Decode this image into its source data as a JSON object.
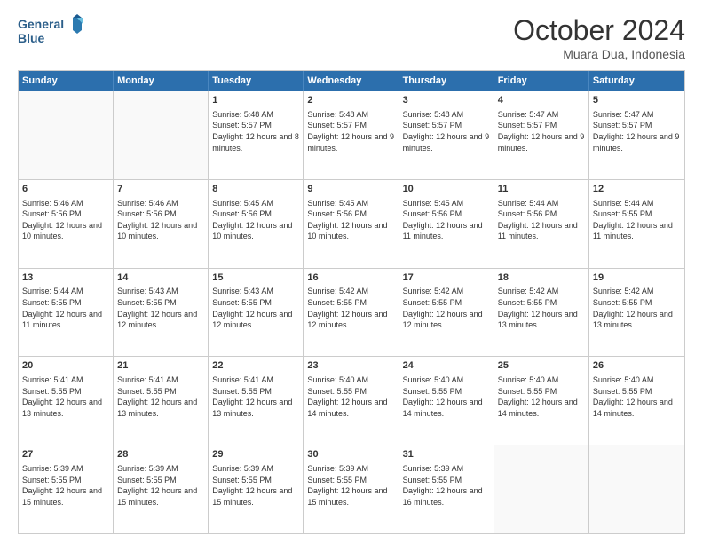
{
  "header": {
    "logo_line1": "General",
    "logo_line2": "Blue",
    "month_title": "October 2024",
    "location": "Muara Dua, Indonesia"
  },
  "weekdays": [
    "Sunday",
    "Monday",
    "Tuesday",
    "Wednesday",
    "Thursday",
    "Friday",
    "Saturday"
  ],
  "rows": [
    [
      {
        "day": "",
        "empty": true
      },
      {
        "day": "",
        "empty": true
      },
      {
        "day": "1",
        "sunrise": "Sunrise: 5:48 AM",
        "sunset": "Sunset: 5:57 PM",
        "daylight": "Daylight: 12 hours and 8 minutes."
      },
      {
        "day": "2",
        "sunrise": "Sunrise: 5:48 AM",
        "sunset": "Sunset: 5:57 PM",
        "daylight": "Daylight: 12 hours and 9 minutes."
      },
      {
        "day": "3",
        "sunrise": "Sunrise: 5:48 AM",
        "sunset": "Sunset: 5:57 PM",
        "daylight": "Daylight: 12 hours and 9 minutes."
      },
      {
        "day": "4",
        "sunrise": "Sunrise: 5:47 AM",
        "sunset": "Sunset: 5:57 PM",
        "daylight": "Daylight: 12 hours and 9 minutes."
      },
      {
        "day": "5",
        "sunrise": "Sunrise: 5:47 AM",
        "sunset": "Sunset: 5:57 PM",
        "daylight": "Daylight: 12 hours and 9 minutes."
      }
    ],
    [
      {
        "day": "6",
        "sunrise": "Sunrise: 5:46 AM",
        "sunset": "Sunset: 5:56 PM",
        "daylight": "Daylight: 12 hours and 10 minutes."
      },
      {
        "day": "7",
        "sunrise": "Sunrise: 5:46 AM",
        "sunset": "Sunset: 5:56 PM",
        "daylight": "Daylight: 12 hours and 10 minutes."
      },
      {
        "day": "8",
        "sunrise": "Sunrise: 5:45 AM",
        "sunset": "Sunset: 5:56 PM",
        "daylight": "Daylight: 12 hours and 10 minutes."
      },
      {
        "day": "9",
        "sunrise": "Sunrise: 5:45 AM",
        "sunset": "Sunset: 5:56 PM",
        "daylight": "Daylight: 12 hours and 10 minutes."
      },
      {
        "day": "10",
        "sunrise": "Sunrise: 5:45 AM",
        "sunset": "Sunset: 5:56 PM",
        "daylight": "Daylight: 12 hours and 11 minutes."
      },
      {
        "day": "11",
        "sunrise": "Sunrise: 5:44 AM",
        "sunset": "Sunset: 5:56 PM",
        "daylight": "Daylight: 12 hours and 11 minutes."
      },
      {
        "day": "12",
        "sunrise": "Sunrise: 5:44 AM",
        "sunset": "Sunset: 5:55 PM",
        "daylight": "Daylight: 12 hours and 11 minutes."
      }
    ],
    [
      {
        "day": "13",
        "sunrise": "Sunrise: 5:44 AM",
        "sunset": "Sunset: 5:55 PM",
        "daylight": "Daylight: 12 hours and 11 minutes."
      },
      {
        "day": "14",
        "sunrise": "Sunrise: 5:43 AM",
        "sunset": "Sunset: 5:55 PM",
        "daylight": "Daylight: 12 hours and 12 minutes."
      },
      {
        "day": "15",
        "sunrise": "Sunrise: 5:43 AM",
        "sunset": "Sunset: 5:55 PM",
        "daylight": "Daylight: 12 hours and 12 minutes."
      },
      {
        "day": "16",
        "sunrise": "Sunrise: 5:42 AM",
        "sunset": "Sunset: 5:55 PM",
        "daylight": "Daylight: 12 hours and 12 minutes."
      },
      {
        "day": "17",
        "sunrise": "Sunrise: 5:42 AM",
        "sunset": "Sunset: 5:55 PM",
        "daylight": "Daylight: 12 hours and 12 minutes."
      },
      {
        "day": "18",
        "sunrise": "Sunrise: 5:42 AM",
        "sunset": "Sunset: 5:55 PM",
        "daylight": "Daylight: 12 hours and 13 minutes."
      },
      {
        "day": "19",
        "sunrise": "Sunrise: 5:42 AM",
        "sunset": "Sunset: 5:55 PM",
        "daylight": "Daylight: 12 hours and 13 minutes."
      }
    ],
    [
      {
        "day": "20",
        "sunrise": "Sunrise: 5:41 AM",
        "sunset": "Sunset: 5:55 PM",
        "daylight": "Daylight: 12 hours and 13 minutes."
      },
      {
        "day": "21",
        "sunrise": "Sunrise: 5:41 AM",
        "sunset": "Sunset: 5:55 PM",
        "daylight": "Daylight: 12 hours and 13 minutes."
      },
      {
        "day": "22",
        "sunrise": "Sunrise: 5:41 AM",
        "sunset": "Sunset: 5:55 PM",
        "daylight": "Daylight: 12 hours and 13 minutes."
      },
      {
        "day": "23",
        "sunrise": "Sunrise: 5:40 AM",
        "sunset": "Sunset: 5:55 PM",
        "daylight": "Daylight: 12 hours and 14 minutes."
      },
      {
        "day": "24",
        "sunrise": "Sunrise: 5:40 AM",
        "sunset": "Sunset: 5:55 PM",
        "daylight": "Daylight: 12 hours and 14 minutes."
      },
      {
        "day": "25",
        "sunrise": "Sunrise: 5:40 AM",
        "sunset": "Sunset: 5:55 PM",
        "daylight": "Daylight: 12 hours and 14 minutes."
      },
      {
        "day": "26",
        "sunrise": "Sunrise: 5:40 AM",
        "sunset": "Sunset: 5:55 PM",
        "daylight": "Daylight: 12 hours and 14 minutes."
      }
    ],
    [
      {
        "day": "27",
        "sunrise": "Sunrise: 5:39 AM",
        "sunset": "Sunset: 5:55 PM",
        "daylight": "Daylight: 12 hours and 15 minutes."
      },
      {
        "day": "28",
        "sunrise": "Sunrise: 5:39 AM",
        "sunset": "Sunset: 5:55 PM",
        "daylight": "Daylight: 12 hours and 15 minutes."
      },
      {
        "day": "29",
        "sunrise": "Sunrise: 5:39 AM",
        "sunset": "Sunset: 5:55 PM",
        "daylight": "Daylight: 12 hours and 15 minutes."
      },
      {
        "day": "30",
        "sunrise": "Sunrise: 5:39 AM",
        "sunset": "Sunset: 5:55 PM",
        "daylight": "Daylight: 12 hours and 15 minutes."
      },
      {
        "day": "31",
        "sunrise": "Sunrise: 5:39 AM",
        "sunset": "Sunset: 5:55 PM",
        "daylight": "Daylight: 12 hours and 16 minutes."
      },
      {
        "day": "",
        "empty": true
      },
      {
        "day": "",
        "empty": true
      }
    ]
  ]
}
